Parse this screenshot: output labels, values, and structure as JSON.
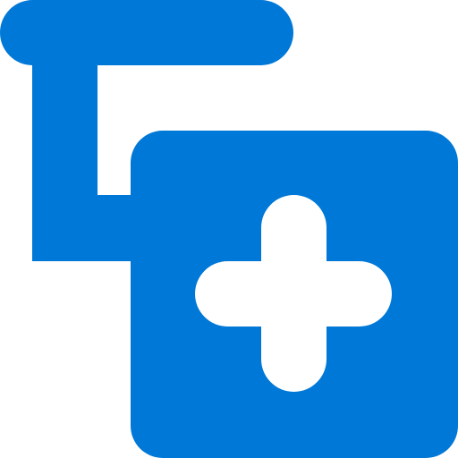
{
  "icon": {
    "name": "add-child-node-icon",
    "colors": {
      "primary": "#0078D7",
      "background": "#FFFFFF"
    }
  }
}
